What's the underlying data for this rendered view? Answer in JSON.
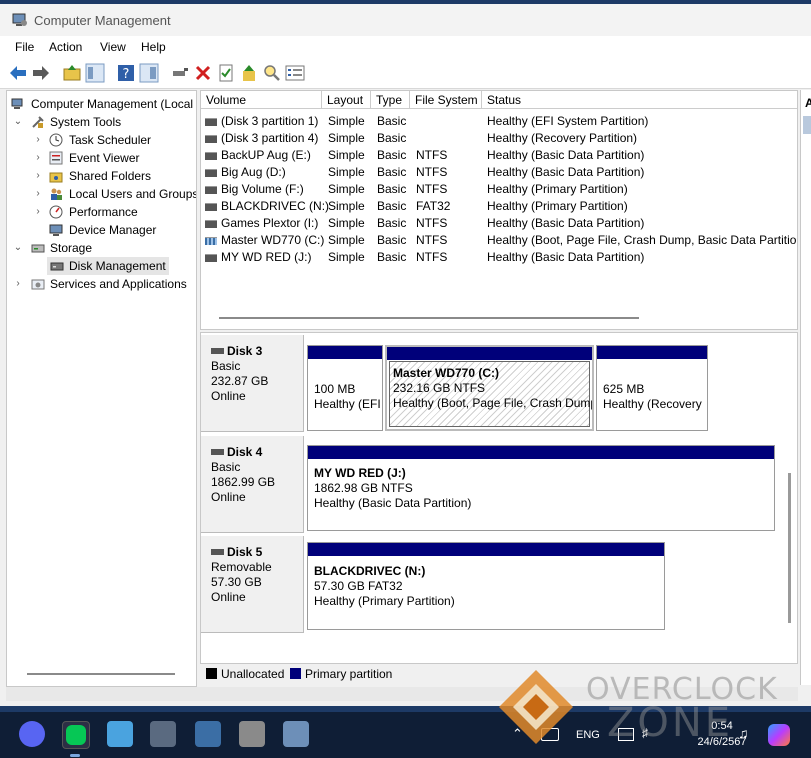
{
  "window": {
    "title": "Computer Management"
  },
  "menu": [
    "File",
    "Action",
    "View",
    "Help"
  ],
  "tree": [
    {
      "label": "Computer Management (Local",
      "level": 0,
      "arrow": "",
      "icon": "computer-management-icon"
    },
    {
      "label": "System Tools",
      "level": 1,
      "arrow": "v",
      "icon": "system-tools-icon"
    },
    {
      "label": "Task Scheduler",
      "level": 2,
      "arrow": ">",
      "icon": "task-scheduler-icon"
    },
    {
      "label": "Event Viewer",
      "level": 2,
      "arrow": ">",
      "icon": "event-viewer-icon"
    },
    {
      "label": "Shared Folders",
      "level": 2,
      "arrow": ">",
      "icon": "shared-folders-icon"
    },
    {
      "label": "Local Users and Groups",
      "level": 2,
      "arrow": ">",
      "icon": "users-icon"
    },
    {
      "label": "Performance",
      "level": 2,
      "arrow": ">",
      "icon": "performance-icon"
    },
    {
      "label": "Device Manager",
      "level": 2,
      "arrow": "",
      "icon": "device-manager-icon"
    },
    {
      "label": "Storage",
      "level": 1,
      "arrow": "v",
      "icon": "storage-icon"
    },
    {
      "label": "Disk Management",
      "level": 2,
      "arrow": "",
      "icon": "disk-management-icon"
    },
    {
      "label": "Services and Applications",
      "level": 1,
      "arrow": ">",
      "icon": "services-icon"
    }
  ],
  "columns": [
    "Volume",
    "Layout",
    "Type",
    "File System",
    "Status"
  ],
  "volumes": [
    {
      "volume": "(Disk 3 partition 1)",
      "layout": "Simple",
      "type": "Basic",
      "fs": "",
      "status": "Healthy (EFI System Partition)"
    },
    {
      "volume": "(Disk 3 partition 4)",
      "layout": "Simple",
      "type": "Basic",
      "fs": "",
      "status": "Healthy (Recovery Partition)"
    },
    {
      "volume": "BackUP Aug (E:)",
      "layout": "Simple",
      "type": "Basic",
      "fs": "NTFS",
      "status": "Healthy (Basic Data Partition)"
    },
    {
      "volume": "Big Aug (D:)",
      "layout": "Simple",
      "type": "Basic",
      "fs": "NTFS",
      "status": "Healthy (Basic Data Partition)"
    },
    {
      "volume": "Big Volume (F:)",
      "layout": "Simple",
      "type": "Basic",
      "fs": "NTFS",
      "status": "Healthy (Primary Partition)"
    },
    {
      "volume": "BLACKDRIVEC (N:)",
      "layout": "Simple",
      "type": "Basic",
      "fs": "FAT32",
      "status": "Healthy (Primary Partition)"
    },
    {
      "volume": "Games Plextor (I:)",
      "layout": "Simple",
      "type": "Basic",
      "fs": "NTFS",
      "status": "Healthy (Basic Data Partition)"
    },
    {
      "volume": "Master WD770 (C:)",
      "layout": "Simple",
      "type": "Basic",
      "fs": "NTFS",
      "status": "Healthy (Boot, Page File, Crash Dump, Basic Data Partition)"
    },
    {
      "volume": "MY WD RED (J:)",
      "layout": "Simple",
      "type": "Basic",
      "fs": "NTFS",
      "status": "Healthy (Basic Data Partition)"
    }
  ],
  "disks": [
    {
      "name": "Disk 3",
      "type": "Basic",
      "size": "232.87 GB",
      "state": "Online",
      "parts": [
        {
          "name": "",
          "size": "100 MB",
          "status": "Healthy (EFI"
        },
        {
          "name": "Master WD770  (C:)",
          "size": "232.16 GB NTFS",
          "status": "Healthy (Boot, Page File, Crash Dump"
        },
        {
          "name": "",
          "size": "625 MB",
          "status": "Healthy (Recovery"
        }
      ]
    },
    {
      "name": "Disk 4",
      "type": "Basic",
      "size": "1862.99 GB",
      "state": "Online",
      "parts": [
        {
          "name": "MY WD RED  (J:)",
          "size": "1862.98 GB NTFS",
          "status": "Healthy (Basic Data Partition)"
        }
      ]
    },
    {
      "name": "Disk 5",
      "type": "Removable",
      "size": "57.30 GB",
      "state": "Online",
      "parts": [
        {
          "name": "BLACKDRIVEC  (N:)",
          "size": "57.30 GB FAT32",
          "status": "Healthy (Primary Partition)"
        }
      ]
    }
  ],
  "legend": [
    {
      "label": "Unallocated",
      "color": "#000000"
    },
    {
      "label": "Primary partition",
      "color": "#00007a"
    }
  ],
  "actions_header": "A",
  "taskbar": {
    "lang": "ENG",
    "time": "0:54",
    "date": "24/6/2567"
  },
  "watermark": {
    "line1": "OVERCLOCK",
    "line2": "ZONE"
  }
}
